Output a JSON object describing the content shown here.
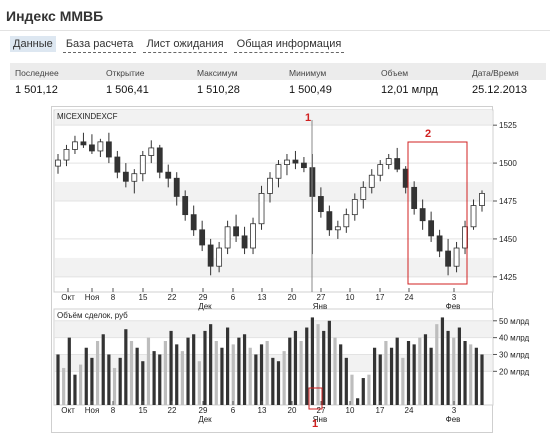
{
  "header": {
    "title": "Индекс ММВБ"
  },
  "tabs": [
    {
      "label": "Данные",
      "active": true
    },
    {
      "label": "База расчета",
      "active": false
    },
    {
      "label": "Лист ожидания",
      "active": false
    },
    {
      "label": "Общая информация",
      "active": false
    }
  ],
  "stats": [
    {
      "label": "Последнее",
      "value": "1 501,12"
    },
    {
      "label": "Открытие",
      "value": "1 506,41"
    },
    {
      "label": "Максимум",
      "value": "1 510,28"
    },
    {
      "label": "Минимум",
      "value": "1 500,49"
    },
    {
      "label": "Объем",
      "value": "12,01 млрд"
    },
    {
      "label": "Дата/Время",
      "value": "25.12.2013"
    }
  ],
  "colors": {
    "accent_tab": "#dde7f1",
    "up_candle": "#ffffff",
    "down_candle": "#333333",
    "annotation": "#d02020"
  },
  "chart_data": [
    {
      "type": "candlestick",
      "title": "MICEXINDEXCF",
      "ylim": [
        1415,
        1535
      ],
      "y_ticks": [
        1425,
        1450,
        1475,
        1500,
        1525
      ],
      "y_tick_labels": [
        "1425",
        "1450",
        "1475",
        "1500",
        "1525"
      ],
      "x_tick_labels": [
        {
          "label": "Окт",
          "row": 0
        },
        {
          "label": "Ноя",
          "row": 0
        },
        {
          "label": "8",
          "row": 0
        },
        {
          "label": "15",
          "row": 0
        },
        {
          "label": "22",
          "row": 0
        },
        {
          "label": "29",
          "row": 0
        },
        {
          "label": "Дек",
          "row": 1
        },
        {
          "label": "6",
          "row": 0
        },
        {
          "label": "13",
          "row": 0
        },
        {
          "label": "20",
          "row": 0
        },
        {
          "label": "27",
          "row": 0
        },
        {
          "label": "Янв",
          "row": 1
        },
        {
          "label": "10",
          "row": 0
        },
        {
          "label": "17",
          "row": 0
        },
        {
          "label": "24",
          "row": 0
        },
        {
          "label": "3",
          "row": 0
        },
        {
          "label": "Фев",
          "row": 1
        }
      ],
      "ohlc": [
        [
          1498,
          1506,
          1493,
          1502
        ],
        [
          1502,
          1512,
          1498,
          1509
        ],
        [
          1509,
          1518,
          1506,
          1514
        ],
        [
          1514,
          1520,
          1510,
          1512
        ],
        [
          1512,
          1519,
          1506,
          1508
        ],
        [
          1508,
          1516,
          1504,
          1514
        ],
        [
          1514,
          1520,
          1500,
          1504
        ],
        [
          1504,
          1508,
          1490,
          1494
        ],
        [
          1494,
          1500,
          1484,
          1488
        ],
        [
          1488,
          1496,
          1480,
          1493
        ],
        [
          1493,
          1508,
          1488,
          1505
        ],
        [
          1505,
          1515,
          1500,
          1510
        ],
        [
          1510,
          1512,
          1490,
          1494
        ],
        [
          1494,
          1499,
          1484,
          1490
        ],
        [
          1490,
          1494,
          1472,
          1478
        ],
        [
          1478,
          1482,
          1462,
          1466
        ],
        [
          1466,
          1472,
          1452,
          1456
        ],
        [
          1456,
          1462,
          1442,
          1446
        ],
        [
          1446,
          1450,
          1426,
          1432
        ],
        [
          1432,
          1448,
          1428,
          1444
        ],
        [
          1444,
          1462,
          1440,
          1458
        ],
        [
          1458,
          1466,
          1448,
          1452
        ],
        [
          1452,
          1458,
          1440,
          1444
        ],
        [
          1444,
          1464,
          1440,
          1460
        ],
        [
          1460,
          1485,
          1456,
          1480
        ],
        [
          1480,
          1494,
          1474,
          1490
        ],
        [
          1490,
          1502,
          1484,
          1499
        ],
        [
          1499,
          1506,
          1492,
          1502
        ],
        [
          1502,
          1508,
          1496,
          1500
        ],
        [
          1500,
          1504,
          1494,
          1497
        ],
        [
          1497,
          1506,
          1440,
          1478
        ],
        [
          1478,
          1484,
          1464,
          1468
        ],
        [
          1468,
          1472,
          1452,
          1456
        ],
        [
          1456,
          1462,
          1450,
          1458
        ],
        [
          1458,
          1470,
          1454,
          1466
        ],
        [
          1466,
          1480,
          1462,
          1476
        ],
        [
          1476,
          1488,
          1470,
          1484
        ],
        [
          1484,
          1496,
          1480,
          1492
        ],
        [
          1492,
          1502,
          1488,
          1499
        ],
        [
          1499,
          1506,
          1496,
          1503
        ],
        [
          1503,
          1510,
          1494,
          1496
        ],
        [
          1496,
          1498,
          1480,
          1484
        ],
        [
          1484,
          1488,
          1466,
          1470
        ],
        [
          1470,
          1476,
          1456,
          1462
        ],
        [
          1462,
          1468,
          1448,
          1452
        ],
        [
          1452,
          1456,
          1438,
          1442
        ],
        [
          1442,
          1450,
          1426,
          1432
        ],
        [
          1432,
          1448,
          1428,
          1444
        ],
        [
          1444,
          1462,
          1440,
          1458
        ],
        [
          1458,
          1476,
          1456,
          1472
        ],
        [
          1472,
          1482,
          1468,
          1480
        ]
      ]
    },
    {
      "type": "bar",
      "title": "Объём сделок, руб",
      "ylim": [
        0,
        57
      ],
      "y_ticks": [
        20,
        30,
        40,
        50
      ],
      "y_tick_labels": [
        "20 млрд",
        "30 млрд",
        "40 млрд",
        "50 млрд"
      ],
      "x_tick_labels": [
        {
          "label": "Окт",
          "row": 0
        },
        {
          "label": "Ноя",
          "row": 0
        },
        {
          "label": "8",
          "row": 0
        },
        {
          "label": "15",
          "row": 0
        },
        {
          "label": "22",
          "row": 0
        },
        {
          "label": "29",
          "row": 0
        },
        {
          "label": "Дек",
          "row": 1
        },
        {
          "label": "6",
          "row": 0
        },
        {
          "label": "13",
          "row": 0
        },
        {
          "label": "20",
          "row": 0
        },
        {
          "label": "27",
          "row": 0
        },
        {
          "label": "Янв",
          "row": 1
        },
        {
          "label": "10",
          "row": 0
        },
        {
          "label": "17",
          "row": 0
        },
        {
          "label": "24",
          "row": 0
        },
        {
          "label": "3",
          "row": 0
        },
        {
          "label": "Фев",
          "row": 1
        }
      ],
      "values": [
        30,
        22,
        40,
        18,
        24,
        34,
        28,
        38,
        42,
        30,
        22,
        28,
        45,
        38,
        34,
        26,
        40,
        32,
        30,
        38,
        44,
        36,
        32,
        40,
        42,
        26,
        44,
        48,
        38,
        34,
        46,
        36,
        40,
        42,
        34,
        30,
        36,
        38,
        28,
        26,
        32,
        40,
        44,
        38,
        46,
        52,
        48,
        44,
        50,
        40,
        36,
        28,
        18,
        4,
        16,
        18,
        34,
        30,
        38,
        34,
        40,
        28,
        38,
        36,
        40,
        42,
        34,
        48,
        52,
        44,
        40,
        46,
        38,
        36,
        34,
        30
      ]
    }
  ],
  "annotations": [
    {
      "label": "1"
    },
    {
      "label": "2"
    },
    {
      "label": "1"
    }
  ]
}
